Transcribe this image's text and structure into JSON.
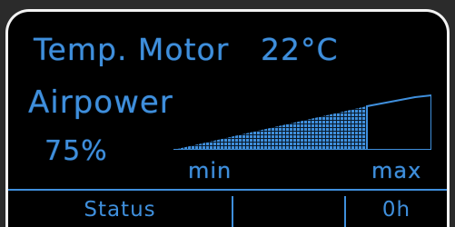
{
  "display": {
    "temp_label": "Temp. Motor",
    "temp_value": "22°C",
    "airpower_label": "Airpower",
    "airpower_percent_text": "75%",
    "airpower_level": 0.75,
    "scale_min_label": "min",
    "scale_max_label": "max"
  },
  "status_bar": {
    "status_label": "Status",
    "middle_label": "",
    "hours_label": "0h"
  },
  "colors": {
    "lcd_text": "#3f8fdc",
    "frame": "#f2f2f2",
    "background": "#000000"
  }
}
